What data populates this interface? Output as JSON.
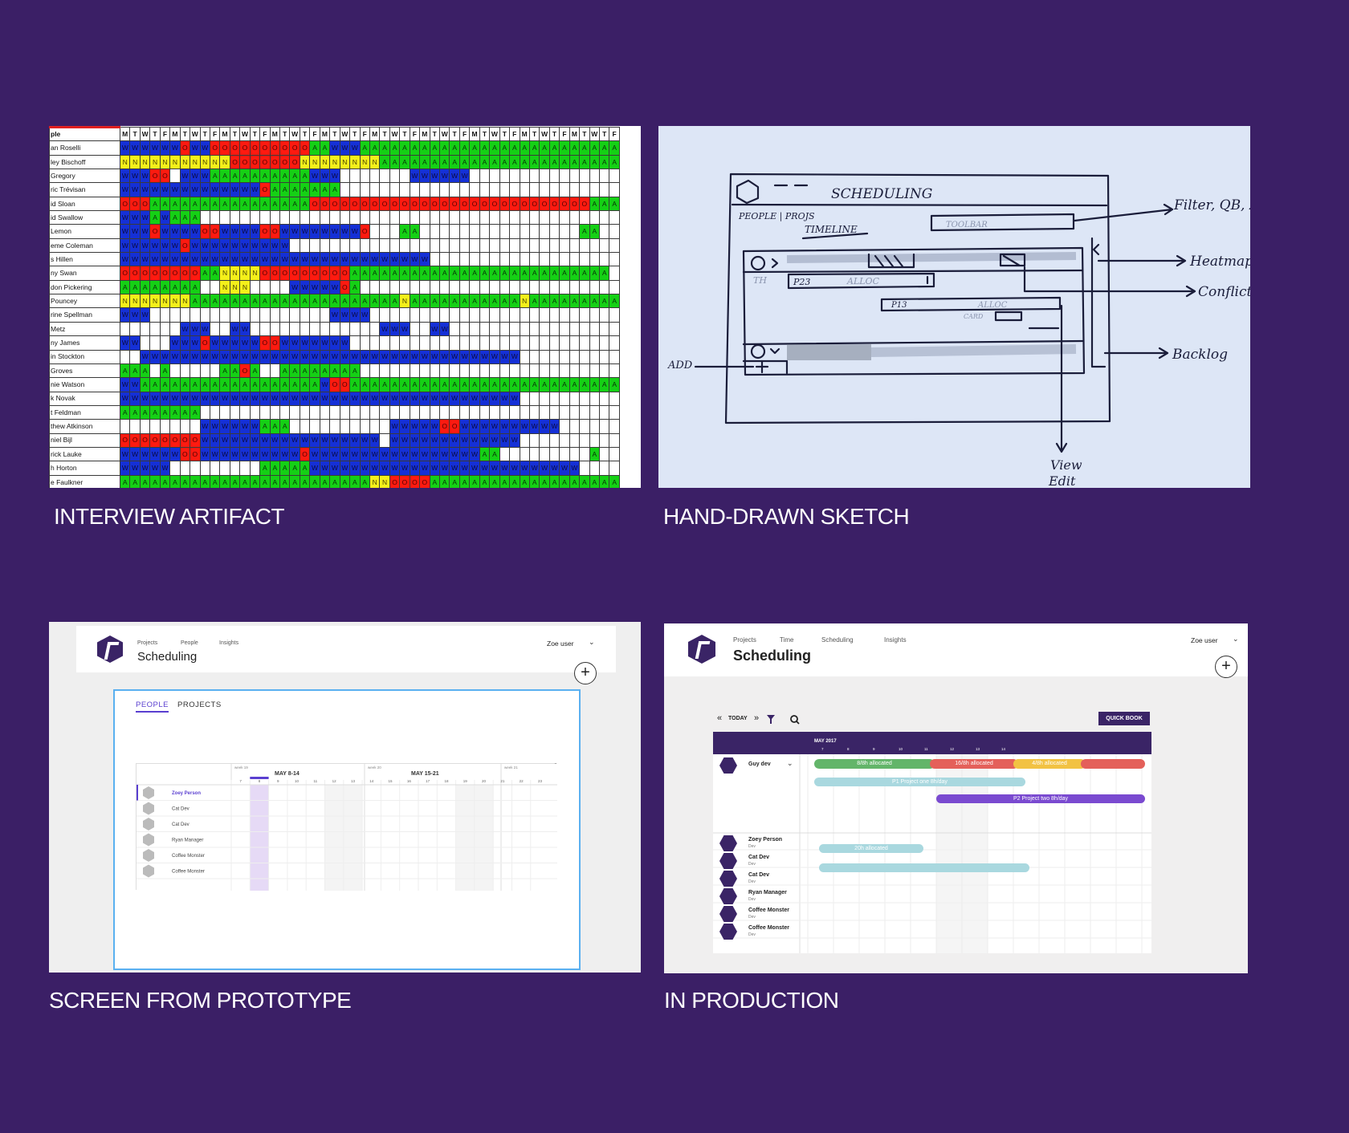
{
  "captions": {
    "artifact": "INTERVIEW ARTIFACT",
    "sketch": "HAND-DRAWN SKETCH",
    "prototype": "SCREEN FROM PROTOTYPE",
    "production": "IN PRODUCTION"
  },
  "colors": {
    "background": "#3b1f66",
    "W": "#1530d6",
    "A": "#15d015",
    "O": "#ff1a10",
    "N": "#f4f01a",
    "brand": "#3a2466"
  },
  "spreadsheet": {
    "header_label": "ple",
    "days": [
      "M",
      "T",
      "W",
      "T",
      "F",
      "M",
      "T",
      "W",
      "T",
      "F",
      "M",
      "T",
      "W",
      "T",
      "F",
      "M",
      "T",
      "W",
      "T",
      "F",
      "M",
      "T",
      "W",
      "T",
      "F",
      "M",
      "T",
      "W",
      "T",
      "F",
      "M",
      "T",
      "W",
      "T",
      "F",
      "M",
      "T",
      "W",
      "T",
      "F",
      "M",
      "T",
      "W",
      "T",
      "F",
      "M",
      "T",
      "W",
      "T",
      "F"
    ],
    "rows": [
      {
        "name": "an Roselli",
        "cells": "WWWWWWOWWOOOOOOOOOOAAWWWAAAAAAAAAAAAAAAAAAAAAAAAAA"
      },
      {
        "name": "ley Bischoff",
        "cells": "NNNNNNNNNNNOOOOOOONNNNNNNNAAAAAAAAAAAAAAAAAAAAAAAA"
      },
      {
        "name": "Gregory",
        "cells": "WWWOO.WWWAAAAAAAAAAWWW.......WWWWWW..............."
      },
      {
        "name": "ric Trévisan",
        "cells": "WWWWWWWWWWWWWWOAAAAAAA............................"
      },
      {
        "name": "id Sloan",
        "cells": "OOOAAAAAAAAAAAAAAAAOOOOOOOOOOOOOOOOOOOOOOOOOOOOAAA"
      },
      {
        "name": "id Swallow",
        "cells": "WWWAWAAA.........................................."
      },
      {
        "name": "Lemon",
        "cells": "WWWOWWWWOOWWWWOOWWWWWWWWO...AA................AA.."
      },
      {
        "name": "eme Coleman",
        "cells": "WWWWWWOWWWWWWWWWW................................."
      },
      {
        "name": "s Hillen",
        "cells": "WWWWWWWWWWWWWWWWWWWWWWWWWWWWWWW..................."
      },
      {
        "name": "ny Swan",
        "cells": "OOOOOOOOAANNNNOOOOOOOOOAAAAAAAAAAAAAAAAAAAAAAAAAA"
      },
      {
        "name": "don Pickering",
        "cells": "AAAAAAAA..NNN....WWWWWOA.........................."
      },
      {
        "name": "Pouncey",
        "cells": "NNNNNNNAAAAAAAAAAAAAAAAAAAAANAAAAAAAAAAANAAAAAAAAA"
      },
      {
        "name": "rine Spellman",
        "cells": "WWW..................WWWW........................."
      },
      {
        "name": "Metz",
        "cells": "......WWW..WW.............WWW..WW................."
      },
      {
        "name": "ny James",
        "cells": "WW...WWWOWWWWWOOWWWWWWW..........................."
      },
      {
        "name": "in Stockton",
        "cells": "..WWWWWWWWWWWWWWWWWWWWWWWWWWWWWWWWWWWWWW.........."
      },
      {
        "name": "Groves",
        "cells": "AAA.A.....AAOA..AAAAAAAA.........................."
      },
      {
        "name": "nie Watson",
        "cells": "WWAAAAAAAAAAAAAAAAAAWOOAAAAAAAAAAAAAAAAAAAAAAAAAAA"
      },
      {
        "name": "k Novak",
        "cells": "WWWWWWWWWWWWWWWWWWWWWWWWWWWWWWWWWWWWWWWW.........."
      },
      {
        "name": "t Feldman",
        "cells": "AAAAAAAA..........................................."
      },
      {
        "name": "thew Atkinson",
        "cells": "........WWWWWWAAA..........WWWWWOOWWWWWWWWWW......."
      },
      {
        "name": "niel Bijl",
        "cells": "OOOOOOOOWWWWWWWWWWWWWWWWWW.WWWWWWWWWWWWW.........."
      },
      {
        "name": "rick Lauke",
        "cells": "WWWWWWOOWWWWWWWWWWOWWWWWWWWWWWWWWWWWAA.........A.."
      },
      {
        "name": "h Horton",
        "cells": "WWWWW.........AAAAAWWWWWWWWWWWWWWWWWWWWWWWWWWW...."
      },
      {
        "name": "e Faulkner",
        "cells": "AAAAAAAAAAAAAAAAAAAAAAAAANNOOOOAAAAAAAAAAAAAAAAAAAA"
      }
    ]
  },
  "sketch": {
    "title": "SCHEDULING",
    "tabs": "PEOPLE | PROJS",
    "timeline": "TIMELINE",
    "toolbar": "TOOLBAR",
    "row_label": "TH",
    "p23": "P23",
    "alloc": "ALLOC",
    "p13": "P13",
    "card": "CARD",
    "add": "ADD",
    "annotations": [
      "Filter, QB, Zo",
      "Heatmap",
      "Conflict",
      "Backlog"
    ],
    "view": "View",
    "edit": "Edit"
  },
  "prototype": {
    "nav": [
      "Projects",
      "People",
      "Insights"
    ],
    "title": "Scheduling",
    "user": "Zoe user",
    "tabs": [
      "PEOPLE",
      "PROJECTS"
    ],
    "weeks": [
      "week 19",
      "MAY 8-14",
      "week 20",
      "MAY 15-21",
      "week 21"
    ],
    "days": [
      "7",
      "8",
      "9",
      "10",
      "11",
      "12",
      "13",
      "14",
      "15",
      "16",
      "17",
      "18",
      "19",
      "20",
      "21",
      "22",
      "23"
    ],
    "people": [
      "Zoey Person",
      "Cat Dev",
      "Cat Dev",
      "Ryan Manager",
      "Coffee Monster",
      "Coffee Monster"
    ]
  },
  "production": {
    "nav": [
      "Projects",
      "Time",
      "Scheduling",
      "Insights"
    ],
    "title": "Scheduling",
    "user": "Zoe user",
    "today": "TODAY",
    "quick_book": "QUICK BOOK",
    "month": "MAY 2017",
    "days": [
      "7",
      "8",
      "9",
      "10",
      "11",
      "12",
      "13",
      "14"
    ],
    "lead": {
      "name": "Guy dev"
    },
    "alloc_bars": [
      "8/8h allocated",
      "16/8h allocated",
      "4/8h allocated"
    ],
    "project_bars": [
      "P1 Project one 8h/day",
      "P2 Project two 8h/day"
    ],
    "person_bar": "20h allocated",
    "people": [
      {
        "name": "Zoey Person",
        "role": "Dev"
      },
      {
        "name": "Cat Dev",
        "role": "Dev"
      },
      {
        "name": "Cat Dev",
        "role": "Dev"
      },
      {
        "name": "Ryan Manager",
        "role": "Dev"
      },
      {
        "name": "Coffee Monster",
        "role": "Dev"
      },
      {
        "name": "Coffee Monster",
        "role": "Dev"
      }
    ]
  }
}
